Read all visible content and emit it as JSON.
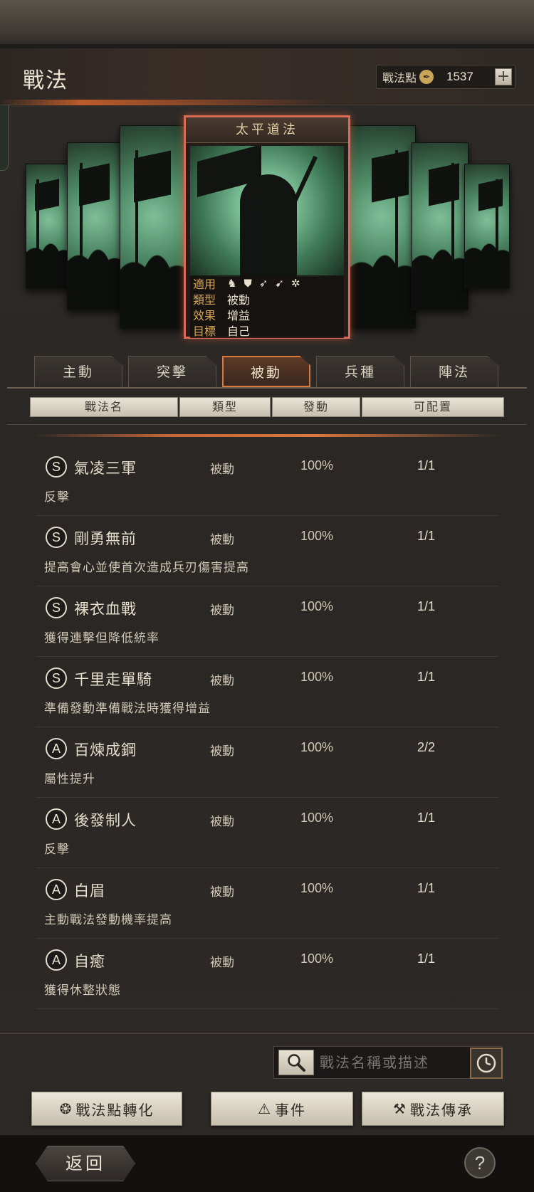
{
  "header": {
    "title": "戰法",
    "points_label": "戰法點",
    "points_value": "1537",
    "points_icon": "feather-coin-icon"
  },
  "featured_card": {
    "name": "太平道法",
    "attributes": [
      {
        "key": "適用",
        "icons": [
          "cavalry-icon",
          "shield-icon",
          "bow-icon",
          "spear-icon",
          "wheel-icon"
        ]
      },
      {
        "key": "類型",
        "value": "被動"
      },
      {
        "key": "效果",
        "value": "增益"
      },
      {
        "key": "目標",
        "value": "自己"
      }
    ]
  },
  "tabs": [
    {
      "label": "主動",
      "active": false
    },
    {
      "label": "突擊",
      "active": false
    },
    {
      "label": "被動",
      "active": true
    },
    {
      "label": "兵種",
      "active": false
    },
    {
      "label": "陣法",
      "active": false
    }
  ],
  "columns": {
    "name": "戰法名",
    "type": "類型",
    "trigger": "發動",
    "slots": "可配置"
  },
  "skills": [
    {
      "grade": "S",
      "name": "氣凌三軍",
      "type": "被動",
      "rate": "100%",
      "slots": "1/1",
      "desc": "反擊"
    },
    {
      "grade": "S",
      "name": "剛勇無前",
      "type": "被動",
      "rate": "100%",
      "slots": "1/1",
      "desc": "提高會心並使首次造成兵刃傷害提高"
    },
    {
      "grade": "S",
      "name": "裸衣血戰",
      "type": "被動",
      "rate": "100%",
      "slots": "1/1",
      "desc": "獲得連擊但降低統率"
    },
    {
      "grade": "S",
      "name": "千里走單騎",
      "type": "被動",
      "rate": "100%",
      "slots": "1/1",
      "desc": "準備發動準備戰法時獲得增益"
    },
    {
      "grade": "A",
      "name": "百煉成鋼",
      "type": "被動",
      "rate": "100%",
      "slots": "2/2",
      "desc": "屬性提升"
    },
    {
      "grade": "A",
      "name": "後發制人",
      "type": "被動",
      "rate": "100%",
      "slots": "1/1",
      "desc": "反擊"
    },
    {
      "grade": "A",
      "name": "白眉",
      "type": "被動",
      "rate": "100%",
      "slots": "1/1",
      "desc": "主動戰法發動機率提高"
    },
    {
      "grade": "A",
      "name": "自癒",
      "type": "被動",
      "rate": "100%",
      "slots": "1/1",
      "desc": "獲得休整狀態"
    }
  ],
  "search": {
    "placeholder": "戰法名稱或描述"
  },
  "actions": {
    "convert": "戰法點轉化",
    "event": "事件",
    "inherit": "戰法傳承"
  },
  "footer": {
    "back": "返回",
    "help": "?"
  },
  "colors": {
    "accent": "#d9773f",
    "card_border": "#d96a55"
  }
}
